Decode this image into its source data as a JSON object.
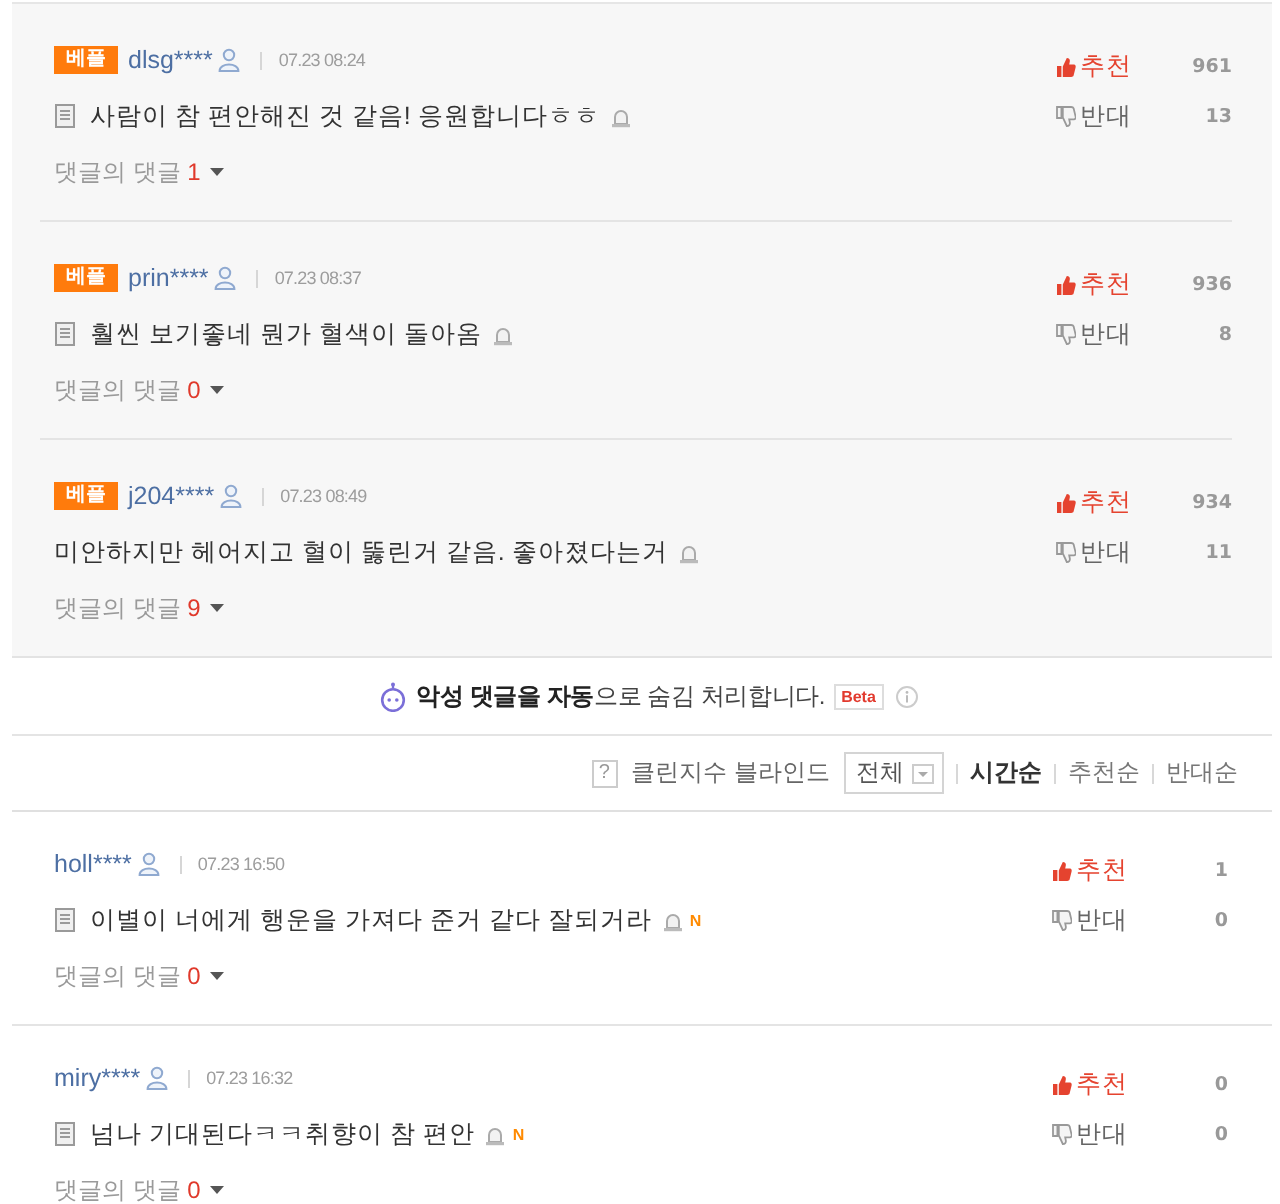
{
  "best_comments": [
    {
      "badge": "베플",
      "username": "dlsg****",
      "time": "07.23 08:24",
      "doc_icon": true,
      "text": "사람이 참 편안해진 것 같음! 응원합니다ㅎㅎ",
      "replies_label": "댓글의 댓글",
      "reply_count": "1",
      "like_label": "추천",
      "like_count": "961",
      "dislike_label": "반대",
      "dislike_count": "13"
    },
    {
      "badge": "베플",
      "username": "prin****",
      "time": "07.23 08:37",
      "doc_icon": true,
      "text": "훨씬 보기좋네 뭔가 혈색이 돌아옴",
      "replies_label": "댓글의 댓글",
      "reply_count": "0",
      "like_label": "추천",
      "like_count": "936",
      "dislike_label": "반대",
      "dislike_count": "8"
    },
    {
      "badge": "베플",
      "username": "j204****",
      "time": "07.23 08:49",
      "doc_icon": false,
      "text": "미안하지만 헤어지고 혈이 뚫린거 같음. 좋아졌다는거",
      "replies_label": "댓글의 댓글",
      "reply_count": "9",
      "like_label": "추천",
      "like_count": "934",
      "dislike_label": "반대",
      "dislike_count": "11"
    }
  ],
  "notice": {
    "text": "**악성 댓글을 자동**으로 숨김 처리합니다.",
    "badge": "Beta"
  },
  "sort_bar": {
    "help": "?",
    "filter_label": "클린지수 블라인드",
    "filter_value": "전체",
    "options": [
      {
        "label": "시간순",
        "selected": true
      },
      {
        "label": "추천순",
        "selected": false
      },
      {
        "label": "반대순",
        "selected": false
      }
    ]
  },
  "comments": [
    {
      "username": "holl****",
      "time": "07.23 16:50",
      "doc_icon": true,
      "text": "이별이 너에게 행운을 가져다 준거 같다 잘되거라",
      "new_badge": "N",
      "replies_label": "댓글의 댓글",
      "reply_count": "0",
      "like_label": "추천",
      "like_count": "1",
      "dislike_label": "반대",
      "dislike_count": "0"
    },
    {
      "username": "miry****",
      "time": "07.23 16:32",
      "doc_icon": true,
      "text": "넘나 기대된다ㅋㅋ취향이 참 편안",
      "new_badge": "N",
      "replies_label": "댓글의 댓글",
      "reply_count": "0",
      "like_label": "추천",
      "like_count": "0",
      "dislike_label": "반대",
      "dislike_count": "0"
    }
  ]
}
